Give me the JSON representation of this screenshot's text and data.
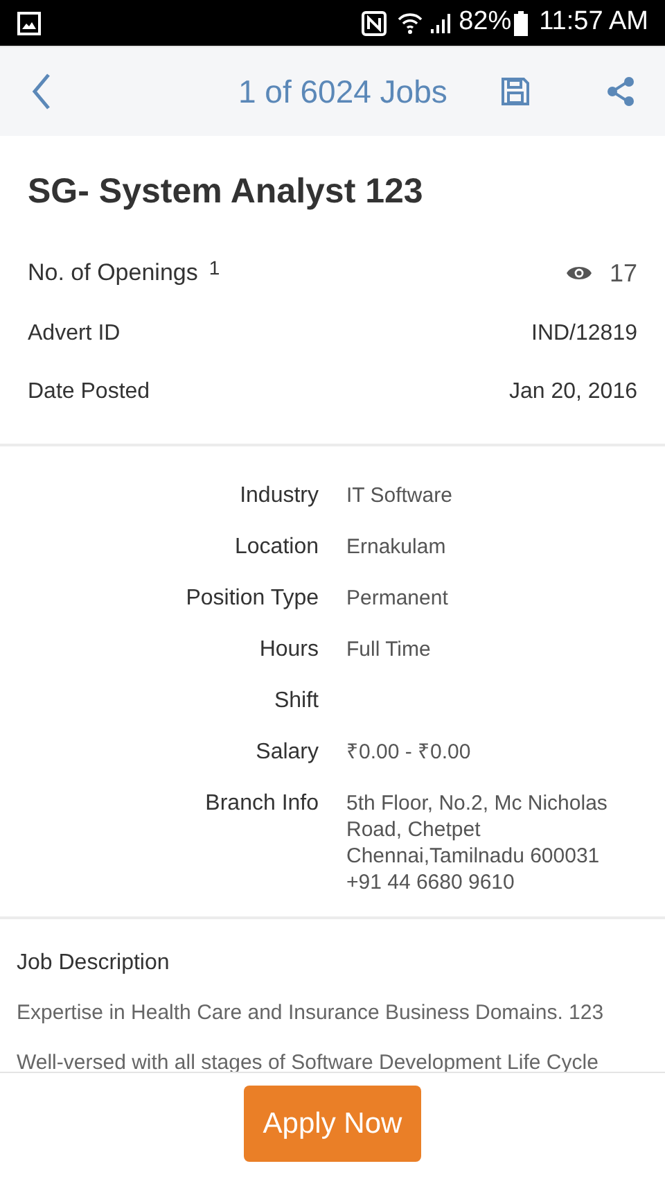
{
  "status_bar": {
    "battery": "82%",
    "time": "11:57 AM"
  },
  "toolbar": {
    "title": "1 of 6024 Jobs"
  },
  "job": {
    "title": "SG- System Analyst 123",
    "openings_label": "No. of Openings",
    "openings": "1",
    "views": "17",
    "meta": [
      {
        "label": "Advert ID",
        "value": "IND/12819"
      },
      {
        "label": "Date Posted",
        "value": "Jan 20, 2016"
      }
    ]
  },
  "details": [
    {
      "label": "Industry",
      "lines": [
        "IT Software"
      ]
    },
    {
      "label": "Location",
      "lines": [
        "Ernakulam"
      ]
    },
    {
      "label": "Position Type",
      "lines": [
        "Permanent"
      ]
    },
    {
      "label": "Hours",
      "lines": [
        "Full Time"
      ]
    },
    {
      "label": "Shift"
    },
    {
      "label": "Salary",
      "lines": [
        "₹0.00 - ₹0.00"
      ]
    },
    {
      "label": "Branch Info",
      "lines": [
        "5th Floor, No.2, Mc Nicholas",
        "Road, Chetpet",
        "Chennai,Tamilnadu 600031",
        "+91 44 6680 9610"
      ]
    }
  ],
  "description": {
    "heading": "Job Description",
    "paragraphs": [
      "Expertise in Health Care and Insurance Business Domains. 123",
      "Well-versed with all stages of Software Development Life Cycle"
    ]
  },
  "apply_button": "Apply Now"
}
